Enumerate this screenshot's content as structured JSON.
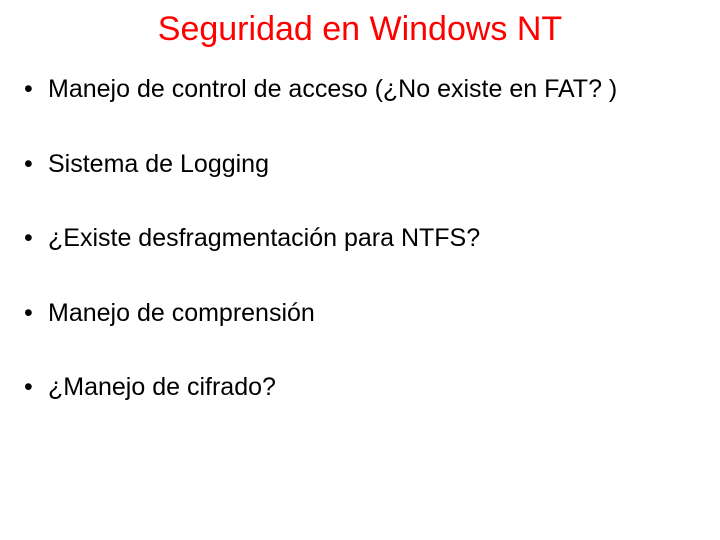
{
  "title": "Seguridad en Windows NT",
  "bullets": [
    "Manejo de control de acceso (¿No existe en FAT? )",
    "Sistema de Logging",
    "¿Existe desfragmentación para NTFS?",
    "Manejo de comprensión",
    "¿Manejo de cifrado?"
  ]
}
